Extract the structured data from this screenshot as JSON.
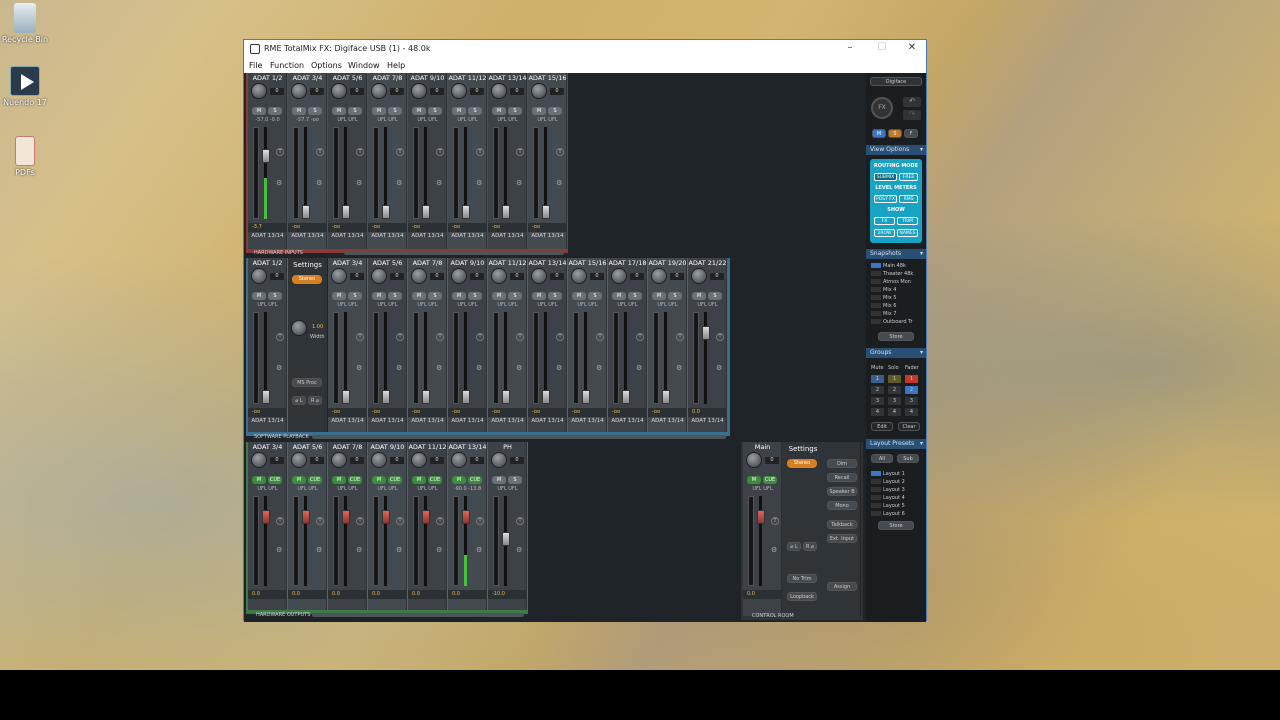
{
  "desktop": {
    "icons": [
      {
        "label": "Recycle Bin"
      },
      {
        "label": "Nuendo 17"
      },
      {
        "label": "PDFs"
      }
    ]
  },
  "window": {
    "title": "RME TotalMix FX: Digiface USB (1) - 48.0k",
    "menu": [
      "File",
      "Function",
      "Options",
      "Window",
      "Help"
    ]
  },
  "row1": {
    "label": "HARDWARE INPUTS",
    "channels": [
      {
        "name": "ADAT 1/2",
        "gain": "0",
        "level": "-3.7",
        "route": "ADAT 13/14",
        "peak": "-57.0 -0.0"
      },
      {
        "name": "ADAT 3/4",
        "gain": "0",
        "level": "-oo",
        "route": "ADAT 13/14",
        "peak": "-57.7 -oo"
      },
      {
        "name": "ADAT 5/6",
        "gain": "0",
        "level": "-oo",
        "route": "ADAT 13/14",
        "peak": "UFL UFL"
      },
      {
        "name": "ADAT 7/8",
        "gain": "0",
        "level": "-oo",
        "route": "ADAT 13/14",
        "peak": "UFL UFL"
      },
      {
        "name": "ADAT 9/10",
        "gain": "0",
        "level": "-oo",
        "route": "ADAT 13/14",
        "peak": "UFL UFL"
      },
      {
        "name": "ADAT 11/12",
        "gain": "0",
        "level": "-oo",
        "route": "ADAT 13/14",
        "peak": "UFL UFL"
      },
      {
        "name": "ADAT 13/14",
        "gain": "0",
        "level": "-oo",
        "route": "ADAT 13/14",
        "peak": "UFL UFL"
      },
      {
        "name": "ADAT 15/16",
        "gain": "0",
        "level": "-oo",
        "route": "ADAT 13/14",
        "peak": "UFL UFL"
      }
    ]
  },
  "row2": {
    "label": "SOFTWARE PLAYBACK",
    "first": {
      "name": "ADAT 1/2",
      "gain": "0",
      "level": "-oo",
      "route": "ADAT 13/14",
      "peak": "UFL UFL"
    },
    "settings": {
      "title": "Settings",
      "stereo": "Stereo",
      "width_val": "1.00",
      "width_lbl": "Width",
      "ms_proc": "MS Proc",
      "phase_l": "⌀ L",
      "phase_r": "R ⌀"
    },
    "channels": [
      {
        "name": "ADAT 3/4",
        "gain": "0",
        "level": "-oo",
        "route": "ADAT 13/14",
        "peak": "UFL UFL"
      },
      {
        "name": "ADAT 5/6",
        "gain": "0",
        "level": "-oo",
        "route": "ADAT 13/14",
        "peak": "UFL UFL"
      },
      {
        "name": "ADAT 7/8",
        "gain": "0",
        "level": "-oo",
        "route": "ADAT 13/14",
        "peak": "UFL UFL"
      },
      {
        "name": "ADAT 9/10",
        "gain": "0",
        "level": "-oo",
        "route": "ADAT 13/14",
        "peak": "UFL UFL"
      },
      {
        "name": "ADAT 11/12",
        "gain": "0",
        "level": "-oo",
        "route": "ADAT 13/14",
        "peak": "UFL UFL"
      },
      {
        "name": "ADAT 13/14",
        "gain": "0",
        "level": "-oo",
        "route": "ADAT 13/14",
        "peak": "UFL UFL"
      },
      {
        "name": "ADAT 15/16",
        "gain": "0",
        "level": "-oo",
        "route": "ADAT 13/14",
        "peak": "UFL UFL"
      },
      {
        "name": "ADAT 17/18",
        "gain": "0",
        "level": "-oo",
        "route": "ADAT 13/14",
        "peak": "UFL UFL"
      },
      {
        "name": "ADAT 19/20",
        "gain": "0",
        "level": "-oo",
        "route": "ADAT 13/14",
        "peak": "UFL UFL"
      },
      {
        "name": "ADAT 21/22",
        "gain": "0",
        "level": "0.0",
        "route": "ADAT 13/14",
        "peak": "UFL UFL"
      }
    ]
  },
  "row3": {
    "label": "HARDWARE OUTPUTS",
    "channels": [
      {
        "name": "ADAT 3/4",
        "gain": "0",
        "level": "0.0",
        "peak": "UFL UFL"
      },
      {
        "name": "ADAT 5/6",
        "gain": "0",
        "level": "0.0",
        "peak": "UFL UFL"
      },
      {
        "name": "ADAT 7/8",
        "gain": "0",
        "level": "0.0",
        "peak": "UFL UFL"
      },
      {
        "name": "ADAT 9/10",
        "gain": "0",
        "level": "0.0",
        "peak": "UFL UFL"
      },
      {
        "name": "ADAT 11/12",
        "gain": "0",
        "level": "0.0",
        "peak": "UFL UFL"
      },
      {
        "name": "ADAT 13/14",
        "gain": "0",
        "level": "0.0",
        "peak": "-90.0 -13.8"
      },
      {
        "name": "PH",
        "gain": "0",
        "level": "-10.0",
        "peak": "UFL UFL"
      }
    ]
  },
  "control_room": {
    "label": "CONTROL ROOM",
    "main": {
      "name": "Main",
      "gain": "0",
      "level": "0.0",
      "peak": "UFL UFL"
    },
    "settings": {
      "title": "Settings",
      "stereo": "Stereo",
      "dim": "Dim",
      "recall": "Recall",
      "speaker_b": "Speaker B",
      "mono": "Mono",
      "talkback": "Talkback",
      "ext_input": "Ext. Input",
      "no_trim": "No Trim",
      "loopback": "Loopback",
      "assign": "Assign",
      "phase_l": "⌀ L",
      "phase_r": "R ⌀"
    }
  },
  "right": {
    "device": "Digiface",
    "fx": "FX",
    "msf": [
      "M",
      "S",
      "F"
    ],
    "view_options": "View Options",
    "routing_mode": "ROUTING MODE",
    "submix": "SUBMIX",
    "free": "FREE",
    "level_meters": "LEVEL METERS",
    "postfx": "POST FX",
    "rms": "RMS",
    "show": "SHOW",
    "fx_btn": "FX",
    "trim": "TRIM",
    "2row": "2ROW",
    "names": "NAMES",
    "snapshots": "Snapshots",
    "snapshot_items": [
      "Main 48k",
      "Theater 48k",
      "Atmos Mon",
      "Mix 4",
      "Mix 5",
      "Mix 6",
      "Mix 7",
      "Outboard Tr"
    ],
    "store": "Store",
    "groups": "Groups",
    "groups_hdr": [
      "Mute",
      "Solo",
      "Fader"
    ],
    "edit": "Edit",
    "clear": "Clear",
    "layout_presets": "Layout Presets",
    "all": "All",
    "sub": "Sub",
    "layouts": [
      "Layout 1",
      "Layout 2",
      "Layout 3",
      "Layout 4",
      "Layout 5",
      "Layout 6"
    ],
    "store2": "Store"
  },
  "colors": {
    "meter_green": "#45c13a",
    "orange": "#d87f24",
    "cyan": "#18a2c4"
  }
}
